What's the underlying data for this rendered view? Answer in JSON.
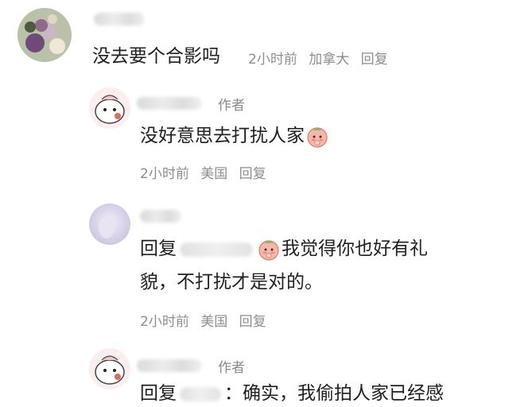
{
  "comments": [
    {
      "text": "没去要个合影吗",
      "time": "2小时前",
      "location": "加拿大",
      "reply_label": "回复"
    },
    {
      "author_tag": "作者",
      "text": "没好意思去打扰人家",
      "time": "2小时前",
      "location": "美国",
      "reply_label": "回复"
    },
    {
      "reply_prefix": "回复",
      "text_line1": "我觉得你也好有礼",
      "text_line2": "貌，不打扰才是对的。",
      "time": "2小时前",
      "location": "美国",
      "reply_label": "回复"
    },
    {
      "author_tag": "作者",
      "reply_prefix": "回复",
      "text": "：确实，我偷拍人家已经感"
    }
  ],
  "icons": {
    "emoji": "shy-peach-emoji",
    "avatar_1": "flower-bouquet-avatar",
    "avatar_2": "cartoon-peach-avatar",
    "avatar_3": "lavender-blur-avatar"
  }
}
